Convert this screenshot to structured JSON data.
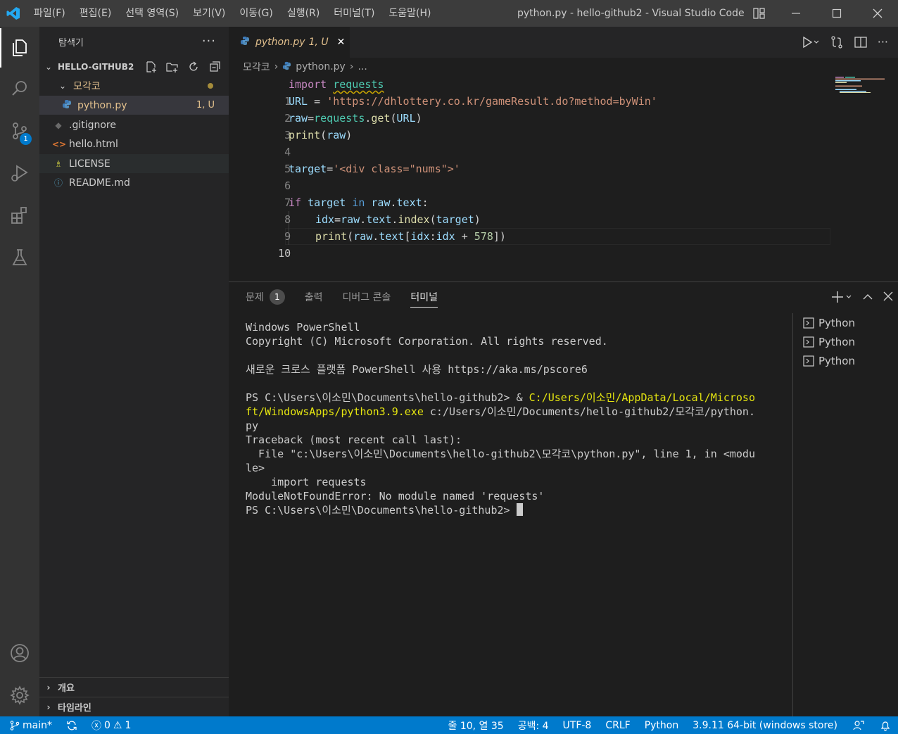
{
  "titlebar": {
    "menus": [
      "파일(F)",
      "편집(E)",
      "선택 영역(S)",
      "보기(V)",
      "이동(G)",
      "실행(R)",
      "터미널(T)",
      "도움말(H)"
    ],
    "title": "python.py - hello-github2 - Visual Studio Code"
  },
  "activity": {
    "source_control_badge": "1"
  },
  "sidebar": {
    "header": "탐색기",
    "more": "···",
    "section_title": "HELLO-GITHUB2",
    "tree": [
      {
        "label": "모각코",
        "type": "folder"
      },
      {
        "label": "python.py",
        "status": "1, U"
      },
      {
        "label": ".gitignore"
      },
      {
        "label": "hello.html"
      },
      {
        "label": "LICENSE"
      },
      {
        "label": "README.md"
      }
    ],
    "outline": "개요",
    "timeline": "타임라인"
  },
  "editor": {
    "tab_name": "python.py",
    "tab_status": "1, U",
    "breadcrumb": [
      "모각코",
      "python.py",
      "..."
    ],
    "line_numbers": [
      "1",
      "2",
      "3",
      "4",
      "5",
      "6",
      "7",
      "8",
      "9",
      "10"
    ],
    "current_line": 10,
    "tokens": {
      "import": "import",
      "requests": "requests",
      "url_var": "URL",
      "eq": " = ",
      "url_str": "'https://dhlottery.co.kr/gameResult.do?method=byWin'",
      "raw": "raw",
      "eq2": "=",
      "get_pre": ".",
      "get": "get",
      "paren_open": "(",
      "url_arg": "URL",
      "paren_close": ")",
      "print": "print",
      "raw_arg": "raw",
      "target": "target",
      "target_str": "'<div class=\"nums\">'",
      "if": "if",
      "in": "in",
      "raw_text": "raw",
      "dot": ".",
      "text": "text",
      "colon": ":",
      "idx": "idx",
      "index": "index",
      "idx_a": "idx",
      "idx_b": "idx",
      "plus": " + ",
      "num": "578",
      "close2": "])"
    }
  },
  "panel": {
    "tabs": [
      {
        "label": "문제",
        "badge": "1"
      },
      {
        "label": "출력"
      },
      {
        "label": "디버그 콘솔"
      },
      {
        "label": "터미널",
        "active": true
      }
    ],
    "terminal_lines": {
      "l1": "Windows PowerShell",
      "l2": "Copyright (C) Microsoft Corporation. All rights reserved.",
      "l3": "새로운 크로스 플랫폼 PowerShell 사용 https://aka.ms/pscore6",
      "l4_prompt": "PS C:\\Users\\이소민\\Documents\\hello-github2> & ",
      "l4_yellow": "C:/Users/이소민/AppData/Local/Microso",
      "l5_yellow": "ft/WindowsApps/python3.9.exe",
      "l5_rest": " c:/Users/이소민/Documents/hello-github2/모각코/python.",
      "l6": "py",
      "l7": "Traceback (most recent call last):",
      "l8": "  File \"c:\\Users\\이소민\\Documents\\hello-github2\\모각코\\python.py\", line 1, in <modu",
      "l9": "le>",
      "l10": "    import requests",
      "l11": "ModuleNotFoundError: No module named 'requests'",
      "l12": "PS C:\\Users\\이소민\\Documents\\hello-github2> "
    },
    "terminal_instances": [
      "Python",
      "Python",
      "Python"
    ]
  },
  "statusbar": {
    "branch": "main*",
    "errors": "0",
    "warnings": "1",
    "cursor_pos": "줄 10, 열 35",
    "spaces": "공백: 4",
    "encoding": "UTF-8",
    "eol": "CRLF",
    "language": "Python",
    "interpreter": "3.9.11 64-bit (windows store)"
  },
  "colors": {
    "accent": "#007acc",
    "untracked": "#73c991",
    "modified": "#e2c08d"
  }
}
